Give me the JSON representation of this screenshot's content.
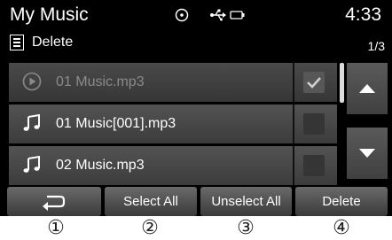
{
  "header": {
    "title": "My Music",
    "time": "4:33",
    "status_icons": [
      "disc-icon",
      "usb-icon",
      "battery-icon"
    ]
  },
  "subheader": {
    "mode_label": "Delete",
    "page_indicator": "1/3"
  },
  "list": {
    "items": [
      {
        "label": "01 Music.mp3",
        "icon": "play-circle-icon",
        "checked": true,
        "dimmed": true
      },
      {
        "label": "01 Music[001].mp3",
        "icon": "music-note-icon",
        "checked": false,
        "dimmed": false
      },
      {
        "label": "02 Music.mp3",
        "icon": "music-note-icon",
        "checked": false,
        "dimmed": false
      }
    ]
  },
  "bottom_bar": {
    "back_icon": "back-arrow-icon",
    "select_all": "Select All",
    "unselect_all": "Unselect All",
    "delete": "Delete"
  },
  "callouts": [
    "①",
    "②",
    "③",
    "④"
  ],
  "colors": {
    "screen_bg": "#000000",
    "row_bg": "#4a4a4a",
    "button_bg": "#5a5a5a",
    "text": "#ffffff",
    "dim_text": "#8a8a8a"
  }
}
